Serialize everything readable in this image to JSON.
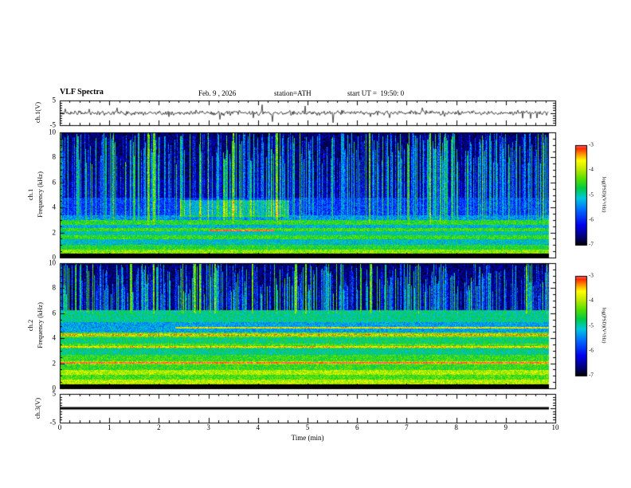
{
  "header": {
    "title": "VLF Spectra",
    "date": "Feb. 9 , 2026",
    "station": "station=ATH",
    "start_ut": "start UT =  19:50: 0"
  },
  "xaxis": {
    "label": "Time (min)",
    "lim": [
      0,
      10
    ],
    "major_ticks": [
      0,
      1,
      2,
      3,
      4,
      5,
      6,
      7,
      8,
      9,
      10
    ],
    "minor_step": 0.2,
    "data_tmax": 9.85
  },
  "colorbar": {
    "label": "log(PSD)(V²/Hz)",
    "range": [
      -7,
      -3
    ],
    "ticks": [
      -3,
      -4,
      -5,
      -6,
      -7
    ],
    "colormap_stops": [
      [
        0.0,
        "#000000"
      ],
      [
        0.08,
        "#000074"
      ],
      [
        0.2,
        "#0000EE"
      ],
      [
        0.36,
        "#0070FF"
      ],
      [
        0.47,
        "#00C8E0"
      ],
      [
        0.57,
        "#00CC44"
      ],
      [
        0.67,
        "#58E000"
      ],
      [
        0.77,
        "#C8EC00"
      ],
      [
        0.85,
        "#FFFF00"
      ],
      [
        0.92,
        "#FF8800"
      ],
      [
        0.97,
        "#FF2800"
      ],
      [
        1.0,
        "#FF6A6A"
      ]
    ]
  },
  "chart_data": [
    {
      "id": "ch1_waveform",
      "type": "line",
      "ylabel": "ch.1(V)",
      "ylim": [
        -5,
        5
      ],
      "yticks": [
        5,
        -5
      ],
      "seed": 11,
      "baseline": 0,
      "noise_amp": 0.55,
      "spike_rate": 0.04,
      "spike_amp": 3.6,
      "line_color": "#000000",
      "description": "noisy broadband signal around 0 V, ~1 V envelope, impulsive spikes down to about -4 V"
    },
    {
      "id": "ch1_spectrogram",
      "type": "heatmap",
      "ylabel_lines": [
        "ch.1",
        "Frequency (kHz)"
      ],
      "ylim": [
        0,
        10
      ],
      "yticks": [
        0,
        2,
        4,
        6,
        8,
        10
      ],
      "seed": 7,
      "noise": 0.8,
      "background_psd": -6.65,
      "bands": [
        {
          "f0": 0.0,
          "f1": 0.3,
          "psd": -7.4
        },
        {
          "f0": 0.3,
          "f1": 0.65,
          "psd": -4.15
        },
        {
          "f0": 0.65,
          "f1": 1.0,
          "psd": -4.6
        },
        {
          "f0": 1.0,
          "f1": 1.45,
          "psd": -5.1
        },
        {
          "f0": 1.45,
          "f1": 1.8,
          "psd": -4.5
        },
        {
          "f0": 1.8,
          "f1": 2.1,
          "psd": -5.0
        },
        {
          "f0": 2.1,
          "f1": 2.35,
          "psd": -4.45
        },
        {
          "f0": 2.35,
          "f1": 2.6,
          "psd": -5.2
        },
        {
          "f0": 2.6,
          "f1": 3.0,
          "psd": -4.55
        },
        {
          "f0": 3.0,
          "f1": 3.4,
          "psd": -5.4
        },
        {
          "f0": 3.4,
          "f1": 4.8,
          "psd": -5.9
        },
        {
          "f0": 4.8,
          "f1": 6.2,
          "psd": -6.5
        },
        {
          "f0": 6.2,
          "f1": 10.0,
          "psd": -6.65
        }
      ],
      "lines": [
        {
          "f": 2.2,
          "t0": 3.0,
          "t1": 4.3,
          "psd": -3.15
        }
      ],
      "patches": [
        {
          "t0": 2.4,
          "t1": 4.6,
          "f0": 3.3,
          "f1": 4.6,
          "dpsd": 0.7
        }
      ],
      "streaks": {
        "density": 0.58,
        "fmin": 2.6,
        "psd_min": -6.1,
        "psd_max": -4.45
      },
      "description": "dark-blue background above 3 kHz crossed by dense vertical sferic streaks; bright green/yellow horizontal bands below 3 kHz; black band below 0.3 kHz"
    },
    {
      "id": "ch2_spectrogram",
      "type": "heatmap",
      "ylabel_lines": [
        "ch.2",
        "Frequency (kHz)"
      ],
      "ylim": [
        0,
        10
      ],
      "yticks": [
        0,
        2,
        4,
        6,
        8,
        10
      ],
      "seed": 23,
      "noise": 0.8,
      "background_psd": -6.65,
      "bands": [
        {
          "f0": 0.0,
          "f1": 0.3,
          "psd": -7.4
        },
        {
          "f0": 0.3,
          "f1": 0.7,
          "psd": -3.95
        },
        {
          "f0": 0.7,
          "f1": 1.1,
          "psd": -4.4
        },
        {
          "f0": 1.1,
          "f1": 1.5,
          "psd": -4.0
        },
        {
          "f0": 1.5,
          "f1": 1.9,
          "psd": -4.5
        },
        {
          "f0": 1.9,
          "f1": 2.2,
          "psd": -4.1
        },
        {
          "f0": 2.2,
          "f1": 2.7,
          "psd": -4.5
        },
        {
          "f0": 2.7,
          "f1": 3.2,
          "psd": -4.9
        },
        {
          "f0": 3.2,
          "f1": 3.6,
          "psd": -4.4
        },
        {
          "f0": 3.6,
          "f1": 4.1,
          "psd": -4.8
        },
        {
          "f0": 4.1,
          "f1": 4.5,
          "psd": -4.3
        },
        {
          "f0": 4.5,
          "f1": 5.3,
          "psd": -5.3
        },
        {
          "f0": 5.3,
          "f1": 6.3,
          "psd": -4.9
        },
        {
          "f0": 6.3,
          "f1": 10.0,
          "psd": -6.65
        }
      ],
      "lines": [
        {
          "f": 2.05,
          "t0": 0.0,
          "t1": 9.85,
          "psd": -3.1
        },
        {
          "f": 3.35,
          "t0": 0.0,
          "t1": 9.85,
          "psd": -3.6
        },
        {
          "f": 4.3,
          "t0": 0.0,
          "t1": 9.85,
          "psd": -3.4
        },
        {
          "f": 4.85,
          "t0": 2.3,
          "t1": 9.85,
          "psd": -3.7
        }
      ],
      "patches": [],
      "streaks": {
        "density": 0.58,
        "fmin": 6.0,
        "psd_min": -6.1,
        "psd_max": -4.45
      },
      "description": "strong yellow/green banding below 6 kHz with thin red power-line harmonics near 2, 3.3, 4.3 and 4.9 kHz; sferic streaks over dark blue above 6.3 kHz; black band below 0.3 kHz"
    },
    {
      "id": "ch3_waveform",
      "type": "line",
      "ylabel": "ch.3(V)",
      "ylim": [
        -5,
        5
      ],
      "yticks": [
        5,
        -5
      ],
      "flat_value": 0,
      "line_width": 3,
      "line_color": "#000000",
      "description": "constant 0 V (no signal), thick flat black trace"
    }
  ]
}
